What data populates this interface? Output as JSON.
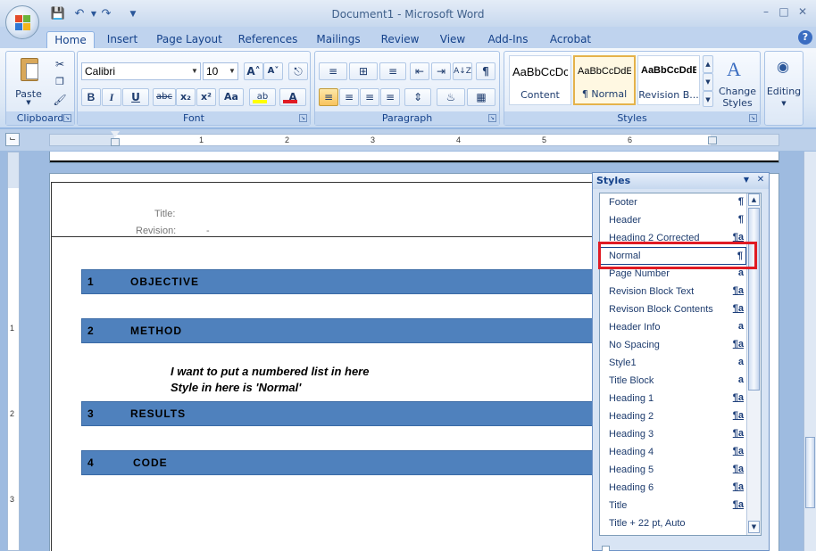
{
  "window": {
    "title": "Document1 - Microsoft Word",
    "minimize": "–",
    "maximize": "□",
    "close": "✕"
  },
  "qat": {
    "save_icon": "save-icon",
    "undo_icon": "undo-icon",
    "redo_icon": "redo-icon"
  },
  "tabs": [
    {
      "label": "Home",
      "active": true
    },
    {
      "label": "Insert"
    },
    {
      "label": "Page Layout"
    },
    {
      "label": "References"
    },
    {
      "label": "Mailings"
    },
    {
      "label": "Review"
    },
    {
      "label": "View"
    },
    {
      "label": "Add-Ins"
    },
    {
      "label": "Acrobat"
    }
  ],
  "help": "?",
  "ribbon": {
    "clipboard": {
      "label": "Clipboard",
      "paste": "Paste"
    },
    "font": {
      "label": "Font",
      "family": "Calibri",
      "size": "10",
      "bold": "B",
      "italic": "I",
      "underline": "U",
      "strike": "abc",
      "sub": "x₂",
      "sup": "x²",
      "case": "Aa",
      "grow": "A˄",
      "shrink": "A˅",
      "highlight": "ab",
      "color": "A"
    },
    "paragraph": {
      "label": "Paragraph",
      "pilcrow": "¶",
      "sort": "A↓Z"
    },
    "styles": {
      "label": "Styles",
      "tiles": [
        {
          "sample": "AaBbCcDc",
          "name": "Content"
        },
        {
          "sample": "AaBbCcDdE",
          "name": "¶ Normal",
          "selected": true
        },
        {
          "sample": "AaBbCcDdEe",
          "name": "Revision B..."
        }
      ],
      "change_styles": "Change Styles",
      "change_styles_line1": "Change",
      "change_styles_line2": "Styles"
    },
    "editing": {
      "label": "Editing"
    }
  },
  "ruler": {
    "numbers": [
      "1",
      "2",
      "3",
      "4",
      "5",
      "6"
    ],
    "vnumbers": [
      "1",
      "2",
      "3"
    ]
  },
  "document": {
    "title_label": "Title:",
    "revision_label": "Revision:",
    "revision_value": "-",
    "headings": [
      {
        "num": "1",
        "text": "OBJECTIVE"
      },
      {
        "num": "2",
        "text": "METHOD"
      },
      {
        "num": "3",
        "text": "RESULTS"
      },
      {
        "num": "4",
        "text": "CODE"
      }
    ],
    "note_line1": "I want to put a numbered list in here",
    "note_line2": "Style in here is 'Normal'"
  },
  "styles_pane": {
    "title": "Styles",
    "items": [
      {
        "name": "Footer",
        "type": "¶"
      },
      {
        "name": "Header",
        "type": "¶"
      },
      {
        "name": "Heading 2 Corrected",
        "type": "¶a"
      },
      {
        "name": "Normal",
        "type": "¶",
        "selected": true
      },
      {
        "name": "Page Number",
        "type": "a"
      },
      {
        "name": "Revision Block Text",
        "type": "¶a"
      },
      {
        "name": "Revison Block Contents",
        "type": "¶a"
      },
      {
        "name": "Header Info",
        "type": "a"
      },
      {
        "name": "No Spacing",
        "type": "¶a"
      },
      {
        "name": "Style1",
        "type": "a"
      },
      {
        "name": "Title Block",
        "type": "a"
      },
      {
        "name": "Heading 1",
        "type": "¶a"
      },
      {
        "name": "Heading 2",
        "type": "¶a"
      },
      {
        "name": "Heading 3",
        "type": "¶a"
      },
      {
        "name": "Heading 4",
        "type": "¶a"
      },
      {
        "name": "Heading 5",
        "type": "¶a"
      },
      {
        "name": "Heading 6",
        "type": "¶a"
      },
      {
        "name": "Title",
        "type": "¶a"
      },
      {
        "name": "Title + 22 pt, Auto",
        "type": ""
      }
    ]
  },
  "colors": {
    "heading_band": "#4f81bd",
    "highlight": "#e01b24",
    "ribbon_text": "#15428b"
  }
}
